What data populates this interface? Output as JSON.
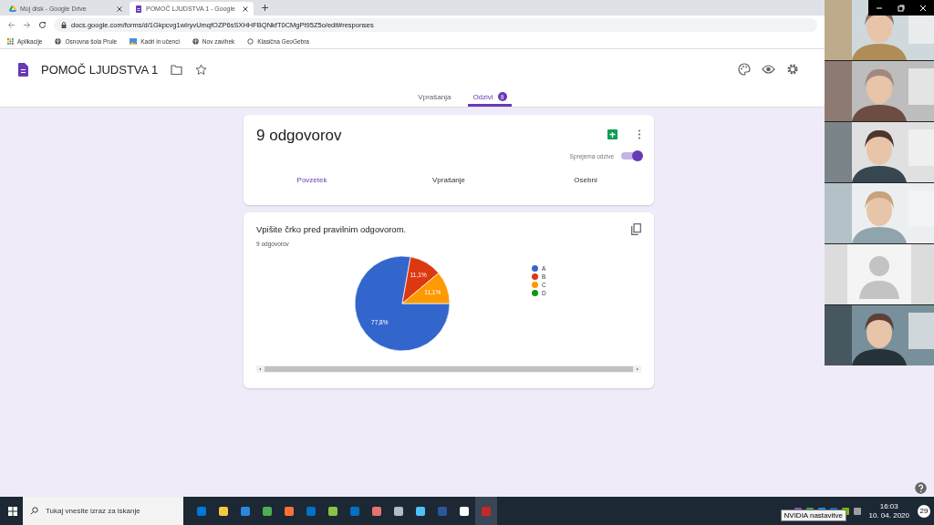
{
  "browser": {
    "tabs": [
      {
        "title": "Moj disk - Google Drive",
        "selected": false
      },
      {
        "title": "POMOČ LJUDSTVA 1 - Google",
        "selected": true
      }
    ],
    "url": "docs.google.com/forms/d/1Gkpcvg1wIryvUmqfOZP6sSXHHFBQNkfT0CMgPt95Z5o/edit#responses",
    "bookmarks": [
      "Aplikacije",
      "Osnovna šola Prule",
      "Kadri in učenci",
      "Nov zavihek",
      "Klasična GeoGebra"
    ]
  },
  "form": {
    "title": "POMOČ LJUDSTVA 1",
    "tabs": [
      {
        "label": "Vprašanja",
        "selected": false
      },
      {
        "label": "Odzivi",
        "badge": "9",
        "selected": true
      }
    ],
    "summary": {
      "title": "9 odgovorov",
      "accepting": {
        "label": "Sprejema odzive",
        "on": true
      },
      "tabs": [
        {
          "label": "Povzetek",
          "selected": true
        },
        {
          "label": "Vprašanje",
          "selected": false
        },
        {
          "label": "Osebni",
          "selected": false
        }
      ]
    },
    "question": {
      "title": "Vpišite črko pred pravilnim odgovorom.",
      "count": "9 odgovorov",
      "chart_data": {
        "type": "pie",
        "categories": [
          "A",
          "B",
          "C",
          "D"
        ],
        "values": [
          77.8,
          11.1,
          11.1,
          0
        ],
        "colors": [
          "#3366cc",
          "#dc3912",
          "#ff9900",
          "#109618"
        ],
        "value_labels": [
          "77,8%",
          "11,1%",
          "11,1%",
          null
        ]
      }
    }
  },
  "video_call": {
    "tiles": [
      {
        "kind": "picture"
      },
      {
        "kind": "picture"
      },
      {
        "kind": "picture"
      },
      {
        "kind": "picture"
      },
      {
        "kind": "avatar"
      },
      {
        "kind": "picture"
      }
    ]
  },
  "taskbar": {
    "search_placeholder": "Tukaj vnesite izraz za iskanje",
    "tooltip": "NVIDIA nastavitve",
    "time": "16:03",
    "date": "10. 04. 2020",
    "notifications": "29"
  }
}
